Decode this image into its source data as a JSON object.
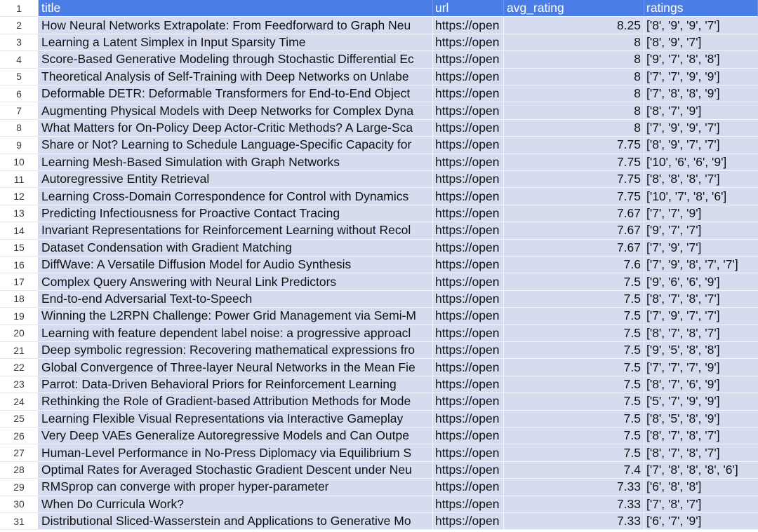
{
  "columns": [
    "title",
    "url",
    "avg_rating",
    "ratings"
  ],
  "header_row_number": "1",
  "rows": [
    {
      "n": "2",
      "title": "How Neural Networks Extrapolate: From Feedforward to Graph Neu",
      "url": "https://open",
      "avg": "8.25",
      "ratings": "['8', '9', '9', '7']"
    },
    {
      "n": "3",
      "title": "Learning a Latent Simplex in Input Sparsity Time",
      "url": "https://open",
      "avg": "8",
      "ratings": "['8', '9', '7']"
    },
    {
      "n": "4",
      "title": "Score-Based Generative Modeling through Stochastic Differential Ec",
      "url": "https://open",
      "avg": "8",
      "ratings": "['9', '7', '8', '8']"
    },
    {
      "n": "5",
      "title": "Theoretical Analysis of Self-Training with Deep Networks on Unlabe",
      "url": "https://open",
      "avg": "8",
      "ratings": "['7', '7', '9', '9']"
    },
    {
      "n": "6",
      "title": "Deformable DETR: Deformable Transformers for End-to-End Object",
      "url": "https://open",
      "avg": "8",
      "ratings": "['7', '8', '8', '9']"
    },
    {
      "n": "7",
      "title": "Augmenting Physical Models with Deep Networks for Complex Dyna",
      "url": "https://open",
      "avg": "8",
      "ratings": "['8', '7', '9']"
    },
    {
      "n": "8",
      "title": "What Matters for On-Policy Deep Actor-Critic Methods? A Large-Sca",
      "url": "https://open",
      "avg": "8",
      "ratings": "['7', '9', '9', '7']"
    },
    {
      "n": "9",
      "title": "Share or Not? Learning to Schedule Language-Specific Capacity for",
      "url": "https://open",
      "avg": "7.75",
      "ratings": "['8', '9', '7', '7']"
    },
    {
      "n": "10",
      "title": "Learning Mesh-Based Simulation with Graph Networks",
      "url": "https://open",
      "avg": "7.75",
      "ratings": "['10', '6', '6', '9']"
    },
    {
      "n": "11",
      "title": "Autoregressive Entity Retrieval",
      "url": "https://open",
      "avg": "7.75",
      "ratings": "['8', '8', '8', '7']"
    },
    {
      "n": "12",
      "title": "Learning Cross-Domain Correspondence for Control with Dynamics",
      "url": "https://open",
      "avg": "7.75",
      "ratings": "['10', '7', '8', '6']"
    },
    {
      "n": "13",
      "title": "Predicting Infectiousness for Proactive Contact Tracing",
      "url": "https://open",
      "avg": "7.67",
      "ratings": "['7', '7', '9']"
    },
    {
      "n": "14",
      "title": "Invariant Representations for Reinforcement Learning without Recol",
      "url": "https://open",
      "avg": "7.67",
      "ratings": "['9', '7', '7']"
    },
    {
      "n": "15",
      "title": "Dataset Condensation with Gradient Matching",
      "url": "https://open",
      "avg": "7.67",
      "ratings": "['7', '9', '7']"
    },
    {
      "n": "16",
      "title": "DiffWave: A Versatile Diffusion Model for Audio Synthesis",
      "url": "https://open",
      "avg": "7.6",
      "ratings": "['7', '9', '8', '7', '7']"
    },
    {
      "n": "17",
      "title": "Complex Query Answering with Neural Link Predictors",
      "url": "https://open",
      "avg": "7.5",
      "ratings": "['9', '6', '6', '9']"
    },
    {
      "n": "18",
      "title": "End-to-end Adversarial Text-to-Speech",
      "url": "https://open",
      "avg": "7.5",
      "ratings": "['8', '7', '8', '7']"
    },
    {
      "n": "19",
      "title": "Winning the L2RPN Challenge: Power Grid Management via Semi-M",
      "url": "https://open",
      "avg": "7.5",
      "ratings": "['7', '9', '7', '7']"
    },
    {
      "n": "20",
      "title": "Learning with feature dependent label noise: a progressive approacl",
      "url": "https://open",
      "avg": "7.5",
      "ratings": "['8', '7', '8', '7']"
    },
    {
      "n": "21",
      "title": "Deep symbolic regression: Recovering mathematical expressions fro",
      "url": "https://open",
      "avg": "7.5",
      "ratings": "['9', '5', '8', '8']"
    },
    {
      "n": "22",
      "title": "Global Convergence of Three-layer Neural Networks in the Mean Fie",
      "url": "https://open",
      "avg": "7.5",
      "ratings": "['7', '7', '7', '9']"
    },
    {
      "n": "23",
      "title": "Parrot: Data-Driven Behavioral Priors for Reinforcement Learning",
      "url": "https://open",
      "avg": "7.5",
      "ratings": "['8', '7', '6', '9']"
    },
    {
      "n": "24",
      "title": "Rethinking the Role of Gradient-based Attribution Methods for Mode",
      "url": "https://open",
      "avg": "7.5",
      "ratings": "['5', '7', '9', '9']"
    },
    {
      "n": "25",
      "title": "Learning Flexible Visual Representations via Interactive Gameplay",
      "url": "https://open",
      "avg": "7.5",
      "ratings": "['8', '5', '8', '9']"
    },
    {
      "n": "26",
      "title": "Very Deep VAEs Generalize Autoregressive Models and Can Outpe",
      "url": "https://open",
      "avg": "7.5",
      "ratings": "['8', '7', '8', '7']"
    },
    {
      "n": "27",
      "title": "Human-Level Performance in No-Press Diplomacy via Equilibrium S",
      "url": "https://open",
      "avg": "7.5",
      "ratings": "['8', '7', '8', '7']"
    },
    {
      "n": "28",
      "title": "Optimal Rates for Averaged Stochastic Gradient Descent under Neu",
      "url": "https://open",
      "avg": "7.4",
      "ratings": "['7', '8', '8', '8', '6']"
    },
    {
      "n": "29",
      "title": "RMSprop can converge with proper hyper-parameter",
      "url": "https://open",
      "avg": "7.33",
      "ratings": "['6', '8', '8']"
    },
    {
      "n": "30",
      "title": "When Do Curricula Work?",
      "url": "https://open",
      "avg": "7.33",
      "ratings": "['7', '8', '7']"
    },
    {
      "n": "31",
      "title": "Distributional Sliced-Wasserstein and Applications to Generative Mo",
      "url": "https://open",
      "avg": "7.33",
      "ratings": "['6', '7', '9']"
    }
  ]
}
